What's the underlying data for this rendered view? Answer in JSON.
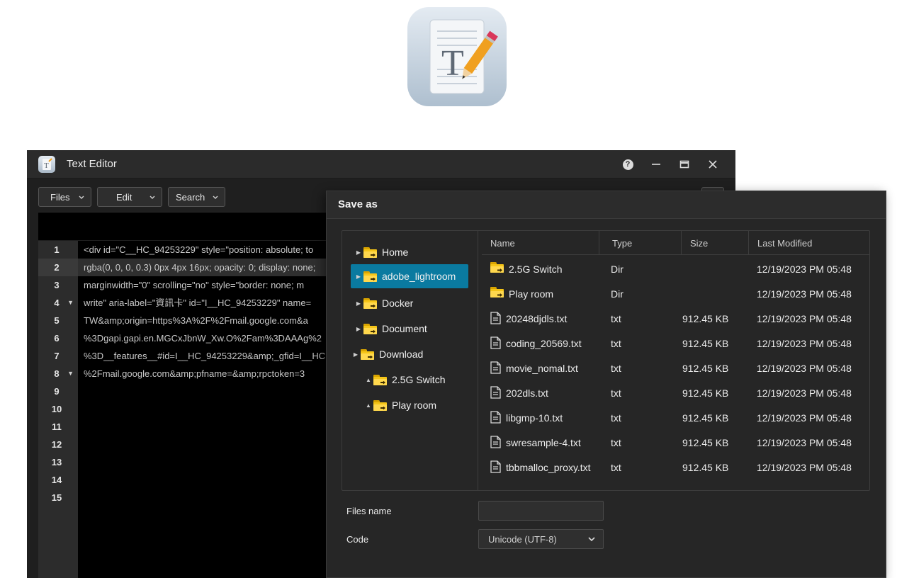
{
  "editor": {
    "title": "Text Editor",
    "toolbar": {
      "files_label": "Files",
      "edit_label": "Edit",
      "search_label": "Search"
    },
    "line_numbers": [
      "1",
      "2",
      "3",
      "4",
      "5",
      "6",
      "7",
      "8",
      "9",
      "10",
      "11",
      "12",
      "13",
      "14",
      "15"
    ],
    "fold_lines": [
      "4",
      "8"
    ],
    "active_line": "2",
    "lines": [
      "<div id=\"C__HC_94253229\" style=\"position: absolute; to",
      "rgba(0, 0, 0, 0.3) 0px 4px 16px; opacity: 0; display: none;",
      "marginwidth=\"0\" scrolling=\"no\" style=\"border: none; m",
      "write\" aria-label=\"資訊卡\" id=\"I__HC_94253229\" name=",
      "TW&amp;origin=https%3A%2F%2Fmail.google.com&a",
      "%3Dgapi.gapi.en.MGCxJbnW_Xw.O%2Fam%3DAAAg%2",
      "%3D__features__#id=I__HC_94253229&amp;_gfid=I__HC",
      "%2Fmail.google.com&amp;pfname=&amp;rpctoken=3"
    ]
  },
  "dialog": {
    "title": "Save as",
    "tree": [
      {
        "label": "Home",
        "arrow": "right",
        "selected": false
      },
      {
        "label": "adobe_lightroom",
        "arrow": "right",
        "selected": true
      },
      {
        "label": "Docker",
        "arrow": "right",
        "selected": false
      },
      {
        "label": "Document",
        "arrow": "right",
        "selected": false
      },
      {
        "label": "Download",
        "arrow": "right",
        "selected": false
      },
      {
        "label": "2.5G Switch",
        "arrow": "up",
        "selected": false
      },
      {
        "label": "Play room",
        "arrow": "up",
        "selected": false
      }
    ],
    "columns": {
      "name": "Name",
      "type": "Type",
      "size": "Size",
      "modified": "Last Modified"
    },
    "files": [
      {
        "name": "2.5G Switch",
        "type": "Dir",
        "size": "",
        "modified": "12/19/2023 PM 05:48",
        "icon": "folder-icon"
      },
      {
        "name": "Play room",
        "type": "Dir",
        "size": "",
        "modified": "12/19/2023 PM 05:48",
        "icon": "folder-icon"
      },
      {
        "name": "20248djdls.txt",
        "type": "txt",
        "size": "912.45 KB",
        "modified": "12/19/2023 PM 05:48",
        "icon": "file-icon"
      },
      {
        "name": "coding_20569.txt",
        "type": "txt",
        "size": "912.45 KB",
        "modified": "12/19/2023 PM 05:48",
        "icon": "file-icon"
      },
      {
        "name": "movie_nomal.txt",
        "type": "txt",
        "size": "912.45 KB",
        "modified": "12/19/2023 PM 05:48",
        "icon": "file-icon"
      },
      {
        "name": "202dls.txt",
        "type": "txt",
        "size": "912.45 KB",
        "modified": "12/19/2023 PM 05:48",
        "icon": "file-icon"
      },
      {
        "name": "libgmp-10.txt",
        "type": "txt",
        "size": "912.45 KB",
        "modified": "12/19/2023 PM 05:48",
        "icon": "file-icon"
      },
      {
        "name": "swresample-4.txt",
        "type": "txt",
        "size": "912.45 KB",
        "modified": "12/19/2023 PM 05:48",
        "icon": "file-icon"
      },
      {
        "name": "tbbmalloc_proxy.txt",
        "type": "txt",
        "size": "912.45 KB",
        "modified": "12/19/2023 PM 05:48",
        "icon": "file-icon"
      }
    ],
    "files_name_label": "Files name",
    "files_name_value": "",
    "code_label": "Code",
    "code_value": "Unicode (UTF-8)"
  },
  "colors": {
    "selection": "#0a7aa0",
    "folder": "#f5c518",
    "window_bg": "#1f1f1f"
  }
}
